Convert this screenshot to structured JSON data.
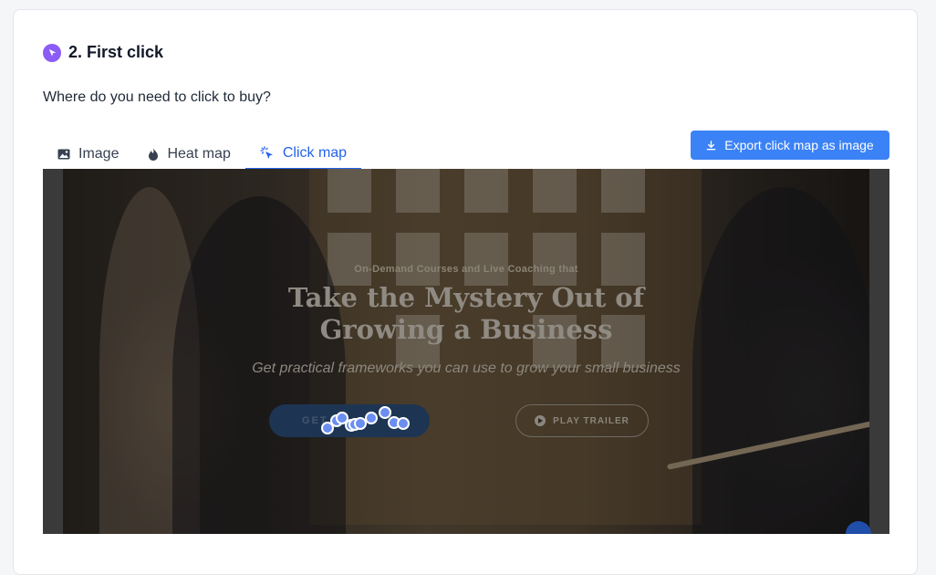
{
  "question": {
    "title": "2. First click",
    "prompt": "Where do you need to click to buy?"
  },
  "tabs": [
    {
      "label": "Image",
      "icon": "image-icon",
      "active": false
    },
    {
      "label": "Heat map",
      "icon": "flame-icon",
      "active": false
    },
    {
      "label": "Click map",
      "icon": "cursor-click-icon",
      "active": true
    }
  ],
  "export": {
    "label": "Export click map as image",
    "icon": "download-icon"
  },
  "screenshot": {
    "subtitle": "On-Demand Courses and Live Coaching that",
    "title_line1": "Take the Mystery Out of",
    "title_line2": "Growing a Business",
    "description": "Get practical frameworks you can use to grow your small business",
    "cta_label": "GET",
    "trailer_label": "PLAY TRAILER"
  },
  "colors": {
    "accent": "#3b82f6",
    "active_tab": "#2563eb",
    "question_badge": "#8b5cf6",
    "click_dot": "#6b8ef0"
  }
}
